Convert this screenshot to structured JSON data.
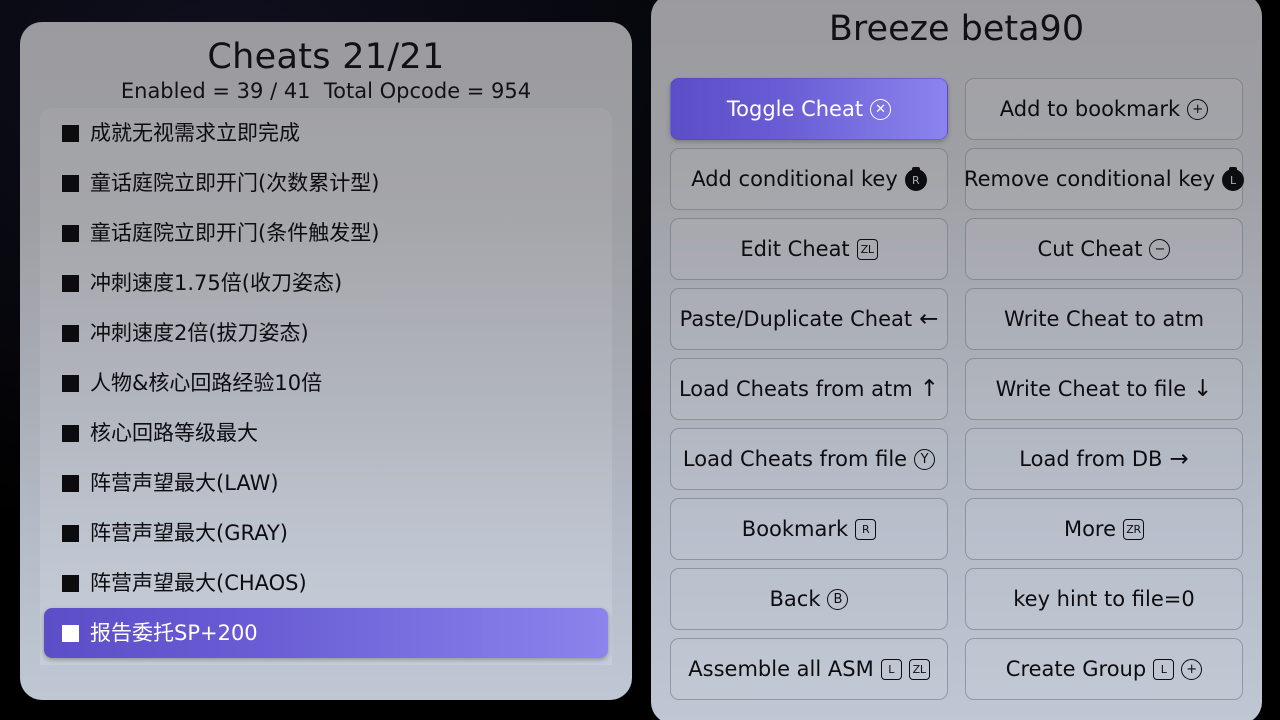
{
  "left_panel": {
    "title": "Cheats 21/21",
    "subtitle": "Enabled = 39 / 41  Total Opcode = 954",
    "cheats": [
      {
        "label": "成就无视需求立即完成",
        "checked": true,
        "selected": false
      },
      {
        "label": "童话庭院立即开门(次数累计型)",
        "checked": true,
        "selected": false
      },
      {
        "label": "童话庭院立即开门(条件触发型)",
        "checked": true,
        "selected": false
      },
      {
        "label": "冲刺速度1.75倍(收刀姿态)",
        "checked": true,
        "selected": false
      },
      {
        "label": "冲刺速度2倍(拔刀姿态)",
        "checked": true,
        "selected": false
      },
      {
        "label": "人物&核心回路经验10倍",
        "checked": true,
        "selected": false
      },
      {
        "label": "核心回路等级最大",
        "checked": true,
        "selected": false
      },
      {
        "label": "阵营声望最大(LAW)",
        "checked": true,
        "selected": false
      },
      {
        "label": "阵营声望最大(GRAY)",
        "checked": true,
        "selected": false
      },
      {
        "label": "阵营声望最大(CHAOS)",
        "checked": true,
        "selected": false
      },
      {
        "label": "报告委托SP+200",
        "checked": true,
        "selected": true
      }
    ]
  },
  "right_panel": {
    "title": "Breeze beta90",
    "buttons": [
      {
        "label": "Toggle Cheat",
        "icon": "x-button-icon",
        "icon_kind": "circle",
        "icon_text": "✕",
        "primary": true
      },
      {
        "label": "Add to bookmark",
        "icon": "plus-circle-icon",
        "icon_kind": "circle",
        "icon_text": "+",
        "primary": false
      },
      {
        "label": "Add conditional key",
        "icon": "zr-trigger-icon",
        "icon_kind": "trigger",
        "icon_text": "R",
        "primary": false
      },
      {
        "label": "Remove conditional key",
        "icon": "zl-trigger-icon",
        "icon_kind": "trigger",
        "icon_text": "L",
        "primary": false
      },
      {
        "label": "Edit Cheat",
        "icon": "zl-button-icon",
        "icon_kind": "square",
        "icon_text": "ZL",
        "primary": false
      },
      {
        "label": "Cut Cheat",
        "icon": "minus-circle-icon",
        "icon_kind": "circle",
        "icon_text": "−",
        "primary": false
      },
      {
        "label": "Paste/Duplicate Cheat",
        "icon": "arrow-left-icon",
        "icon_kind": "arrow",
        "icon_text": "←",
        "primary": false
      },
      {
        "label": "Write Cheat to atm",
        "icon": "",
        "icon_kind": "none",
        "icon_text": "",
        "primary": false
      },
      {
        "label": "Load Cheats from atm",
        "icon": "arrow-up-icon",
        "icon_kind": "arrow",
        "icon_text": "↑",
        "primary": false
      },
      {
        "label": "Write Cheat to file",
        "icon": "arrow-down-icon",
        "icon_kind": "arrow",
        "icon_text": "↓",
        "primary": false
      },
      {
        "label": "Load Cheats from file",
        "icon": "y-button-icon",
        "icon_kind": "circle",
        "icon_text": "Y",
        "primary": false
      },
      {
        "label": "Load from DB",
        "icon": "arrow-right-icon",
        "icon_kind": "arrow",
        "icon_text": "→",
        "primary": false
      },
      {
        "label": "Bookmark",
        "icon": "r-button-icon",
        "icon_kind": "square",
        "icon_text": "R",
        "primary": false
      },
      {
        "label": "More",
        "icon": "zr-button-icon",
        "icon_kind": "square",
        "icon_text": "ZR",
        "primary": false
      },
      {
        "label": "Back",
        "icon": "b-button-icon",
        "icon_kind": "circle",
        "icon_text": "B",
        "primary": false
      },
      {
        "label": "key hint to file=0",
        "icon": "",
        "icon_kind": "none",
        "icon_text": "",
        "primary": false
      },
      {
        "label": "Assemble all ASM",
        "icon": "l-button-icon",
        "icon_kind": "square",
        "icon_text": "L",
        "icon2": "zl-button-icon",
        "icon2_kind": "square",
        "icon2_text": "ZL",
        "primary": false
      },
      {
        "label": "Create Group",
        "icon": "l-button-icon",
        "icon_kind": "square",
        "icon_text": "L",
        "icon2": "plus-circle-icon",
        "icon2_kind": "circle",
        "icon2_text": "+",
        "primary": false
      }
    ]
  },
  "colors": {
    "accent_purple_dark": "#5b4ec6",
    "accent_purple_light": "#8b84ee",
    "panel_top": "#9b9b9f",
    "panel_bottom": "#bfc7d4",
    "background": "#000000",
    "text": "#0d0d11"
  }
}
